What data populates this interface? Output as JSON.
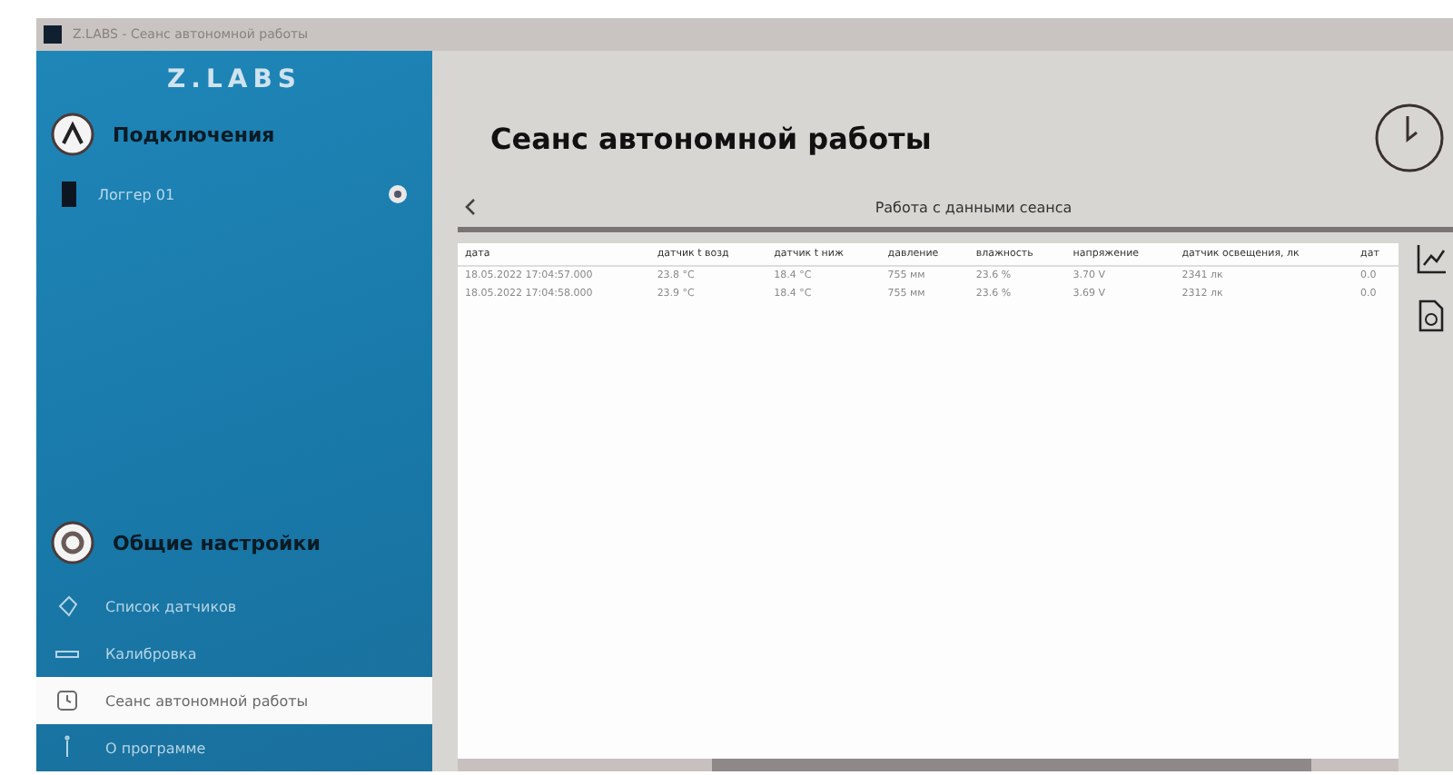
{
  "window": {
    "title": "Z.LABS - Сеанс автономной работы"
  },
  "sidebar": {
    "logo": "Z.LABS",
    "connections": {
      "title": "Подключения",
      "devices": [
        {
          "name": "Логгер 01"
        }
      ]
    },
    "settings": {
      "title": "Общие настройки",
      "items": [
        {
          "label": "Список датчиков",
          "kind": "tag",
          "selected": false
        },
        {
          "label": "Калибровка",
          "kind": "ruler",
          "selected": false
        },
        {
          "label": "Сеанс автономной работы",
          "kind": "clock",
          "selected": true
        },
        {
          "label": "О программе",
          "kind": "info",
          "selected": false
        }
      ]
    }
  },
  "page": {
    "title": "Сеанс автономной работы",
    "subtitle": "Работа с данными сеанса"
  },
  "table": {
    "columns": [
      "дата",
      "датчик t возд",
      "датчик t ниж",
      "давление",
      "влажность",
      "напряжение",
      "датчик освещения, лк",
      "дат"
    ],
    "rows": [
      [
        "18.05.2022 17:04:57.000",
        "23.8 °C",
        "18.4 °C",
        "755 мм",
        "23.6 %",
        "3.70 V",
        "2341 лк",
        "0.0"
      ],
      [
        "18.05.2022 17:04:58.000",
        "23.9 °C",
        "18.4 °C",
        "755 мм",
        "23.6 %",
        "3.69 V",
        "2312 лк",
        "0.0"
      ]
    ]
  }
}
